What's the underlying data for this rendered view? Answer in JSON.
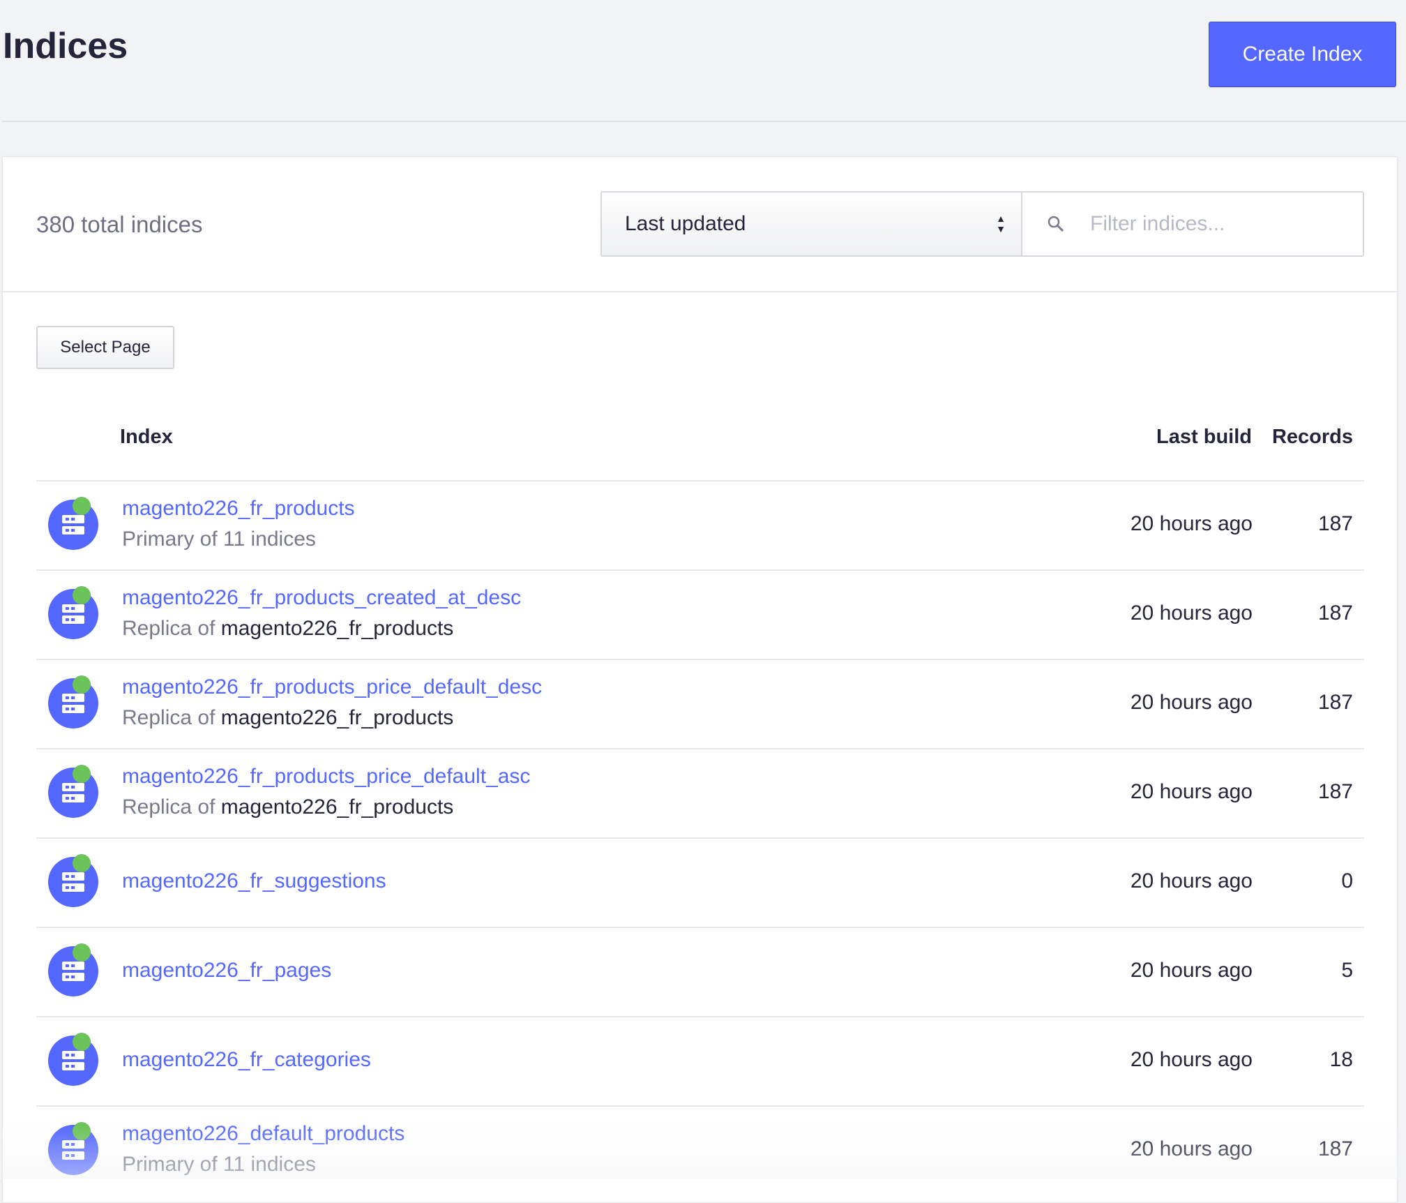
{
  "header": {
    "title": "Indices",
    "create_label": "Create Index"
  },
  "toolbar": {
    "total": "380 total indices",
    "sort_value": "Last updated",
    "filter_placeholder": "Filter indices...",
    "select_page_label": "Select Page"
  },
  "table": {
    "columns": {
      "index": "Index",
      "last_build": "Last build",
      "records": "Records"
    },
    "rows": [
      {
        "name": "magento226_fr_products",
        "sub_prefix": "Primary of 11 indices",
        "sub_target": "",
        "last_build": "20 hours ago",
        "records": "187"
      },
      {
        "name": "magento226_fr_products_created_at_desc",
        "sub_prefix": "Replica of ",
        "sub_target": "magento226_fr_products",
        "last_build": "20 hours ago",
        "records": "187"
      },
      {
        "name": "magento226_fr_products_price_default_desc",
        "sub_prefix": "Replica of ",
        "sub_target": "magento226_fr_products",
        "last_build": "20 hours ago",
        "records": "187"
      },
      {
        "name": "magento226_fr_products_price_default_asc",
        "sub_prefix": "Replica of ",
        "sub_target": "magento226_fr_products",
        "last_build": "20 hours ago",
        "records": "187"
      },
      {
        "name": "magento226_fr_suggestions",
        "sub_prefix": "",
        "sub_target": "",
        "last_build": "20 hours ago",
        "records": "0"
      },
      {
        "name": "magento226_fr_pages",
        "sub_prefix": "",
        "sub_target": "",
        "last_build": "20 hours ago",
        "records": "5"
      },
      {
        "name": "magento226_fr_categories",
        "sub_prefix": "",
        "sub_target": "",
        "last_build": "20 hours ago",
        "records": "18"
      },
      {
        "name": "magento226_default_products",
        "sub_prefix": "Primary of 11 indices",
        "sub_target": "",
        "last_build": "20 hours ago",
        "records": "187"
      }
    ]
  }
}
